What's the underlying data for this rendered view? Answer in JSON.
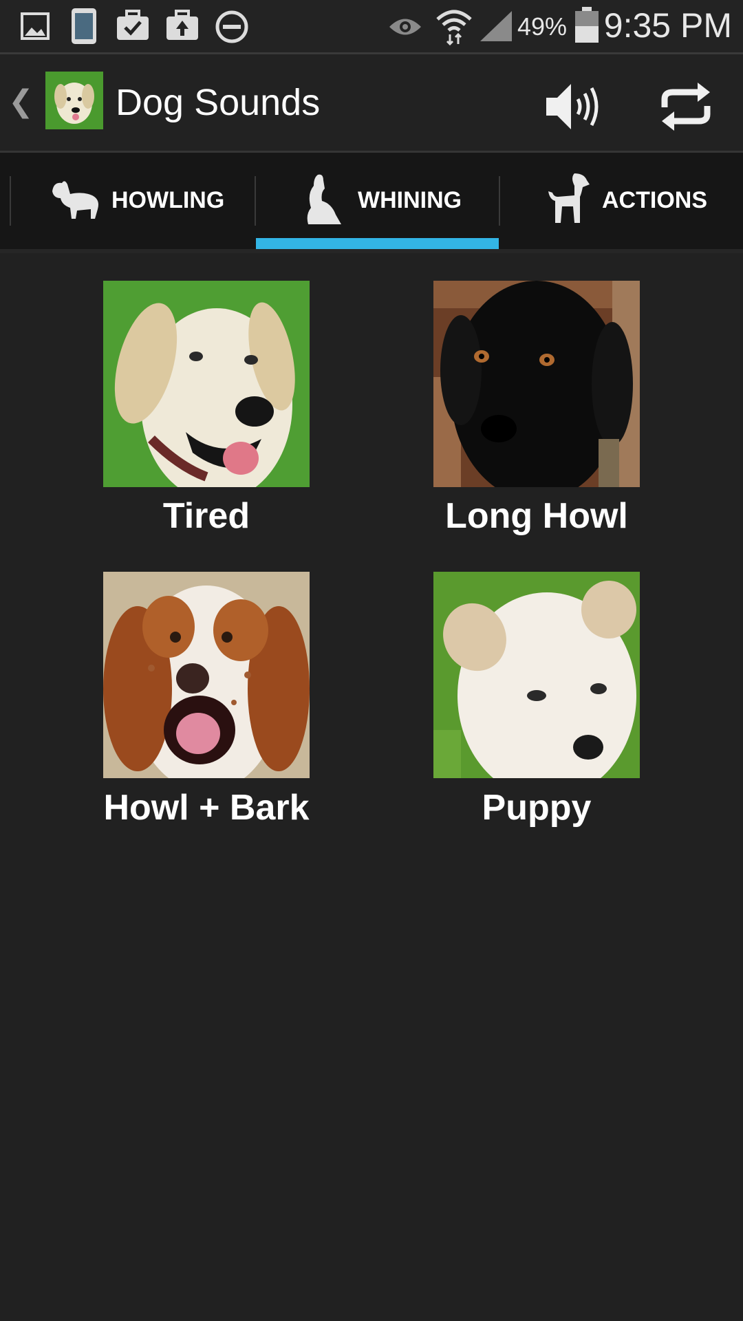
{
  "status_bar": {
    "icons": [
      "gallery-icon",
      "phone-screen-icon",
      "briefcase-check-icon",
      "briefcase-upload-icon",
      "minus-circle-icon",
      "eye-icon",
      "wifi-icon",
      "cell-signal-icon",
      "battery-icon"
    ],
    "battery_percent": "49%",
    "time": "9:35 PM"
  },
  "action_bar": {
    "title": "Dog Sounds"
  },
  "tabs": [
    {
      "label": "HOWLING",
      "icon": "dog-howling-icon"
    },
    {
      "label": "WHINING",
      "icon": "dog-sitting-icon",
      "selected": true
    },
    {
      "label": "ACTIONS",
      "icon": "dog-standing-icon"
    }
  ],
  "sounds": [
    {
      "label": "Tired",
      "image": "yellow-lab-photo"
    },
    {
      "label": "Long Howl",
      "image": "black-lab-photo"
    },
    {
      "label": "Howl + Bark",
      "image": "spaniel-photo"
    },
    {
      "label": "Puppy",
      "image": "white-puppy-photo"
    }
  ],
  "colors": {
    "background": "#212121",
    "tab_indicator": "#33b5e5",
    "tab_bar": "#161616"
  }
}
